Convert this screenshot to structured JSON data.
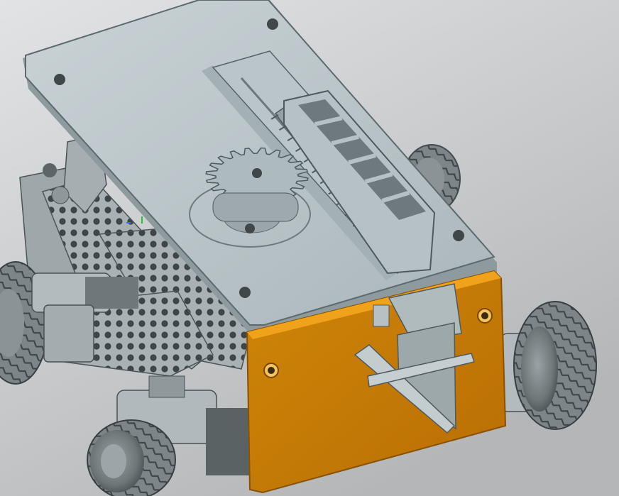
{
  "scene": {
    "background_top": "#e2e3e4",
    "background_bottom": "#b4b6b8",
    "plate_color": "#b8c4c8",
    "metal_color": "#aab2b5",
    "metal_dark": "#5c6466",
    "orange_plate_color": "#c97d06",
    "orange_edge_color": "#f0a21a",
    "tire_color": "#6e7678",
    "axis_green": "#1fc63a",
    "axis_blue": "#3d6bff"
  },
  "components": [
    "top-plate",
    "gear",
    "gear-rack",
    "rack-guide-rail",
    "compartment-tray",
    "orange-front-plate",
    "front-bracket",
    "side-frame",
    "motors",
    "wheels"
  ]
}
